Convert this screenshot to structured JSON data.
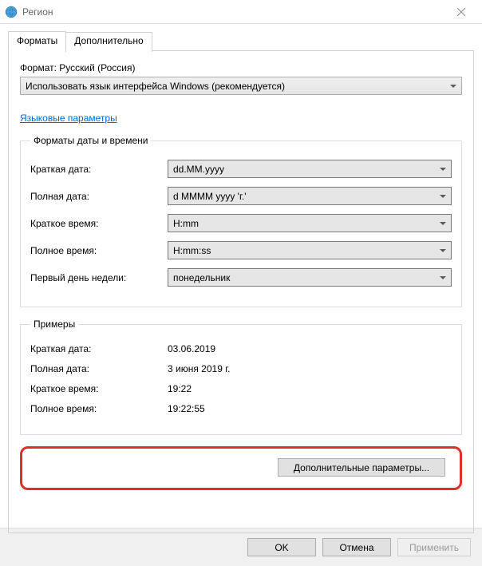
{
  "window": {
    "title": "Регион"
  },
  "tabs": {
    "formats": "Форматы",
    "advanced": "Дополнительно"
  },
  "format": {
    "label": "Формат: Русский (Россия)",
    "selected": "Использовать язык интерфейса Windows (рекомендуется)"
  },
  "link_language": "Языковые параметры",
  "group_datetime": {
    "legend": "Форматы даты и времени",
    "short_date_label": "Краткая дата:",
    "short_date_value": "dd.MM.yyyy",
    "long_date_label": "Полная дата:",
    "long_date_value": "d MMMM yyyy 'г.'",
    "short_time_label": "Краткое время:",
    "short_time_value": "H:mm",
    "long_time_label": "Полное время:",
    "long_time_value": "H:mm:ss",
    "first_day_label": "Первый день недели:",
    "first_day_value": "понедельник"
  },
  "group_examples": {
    "legend": "Примеры",
    "short_date_label": "Краткая дата:",
    "short_date_value": "03.06.2019",
    "long_date_label": "Полная дата:",
    "long_date_value": "3 июня 2019 г.",
    "short_time_label": "Краткое время:",
    "short_time_value": "19:22",
    "long_time_label": "Полное время:",
    "long_time_value": "19:22:55"
  },
  "buttons": {
    "additional": "Дополнительные параметры...",
    "ok": "OK",
    "cancel": "Отмена",
    "apply": "Применить"
  }
}
